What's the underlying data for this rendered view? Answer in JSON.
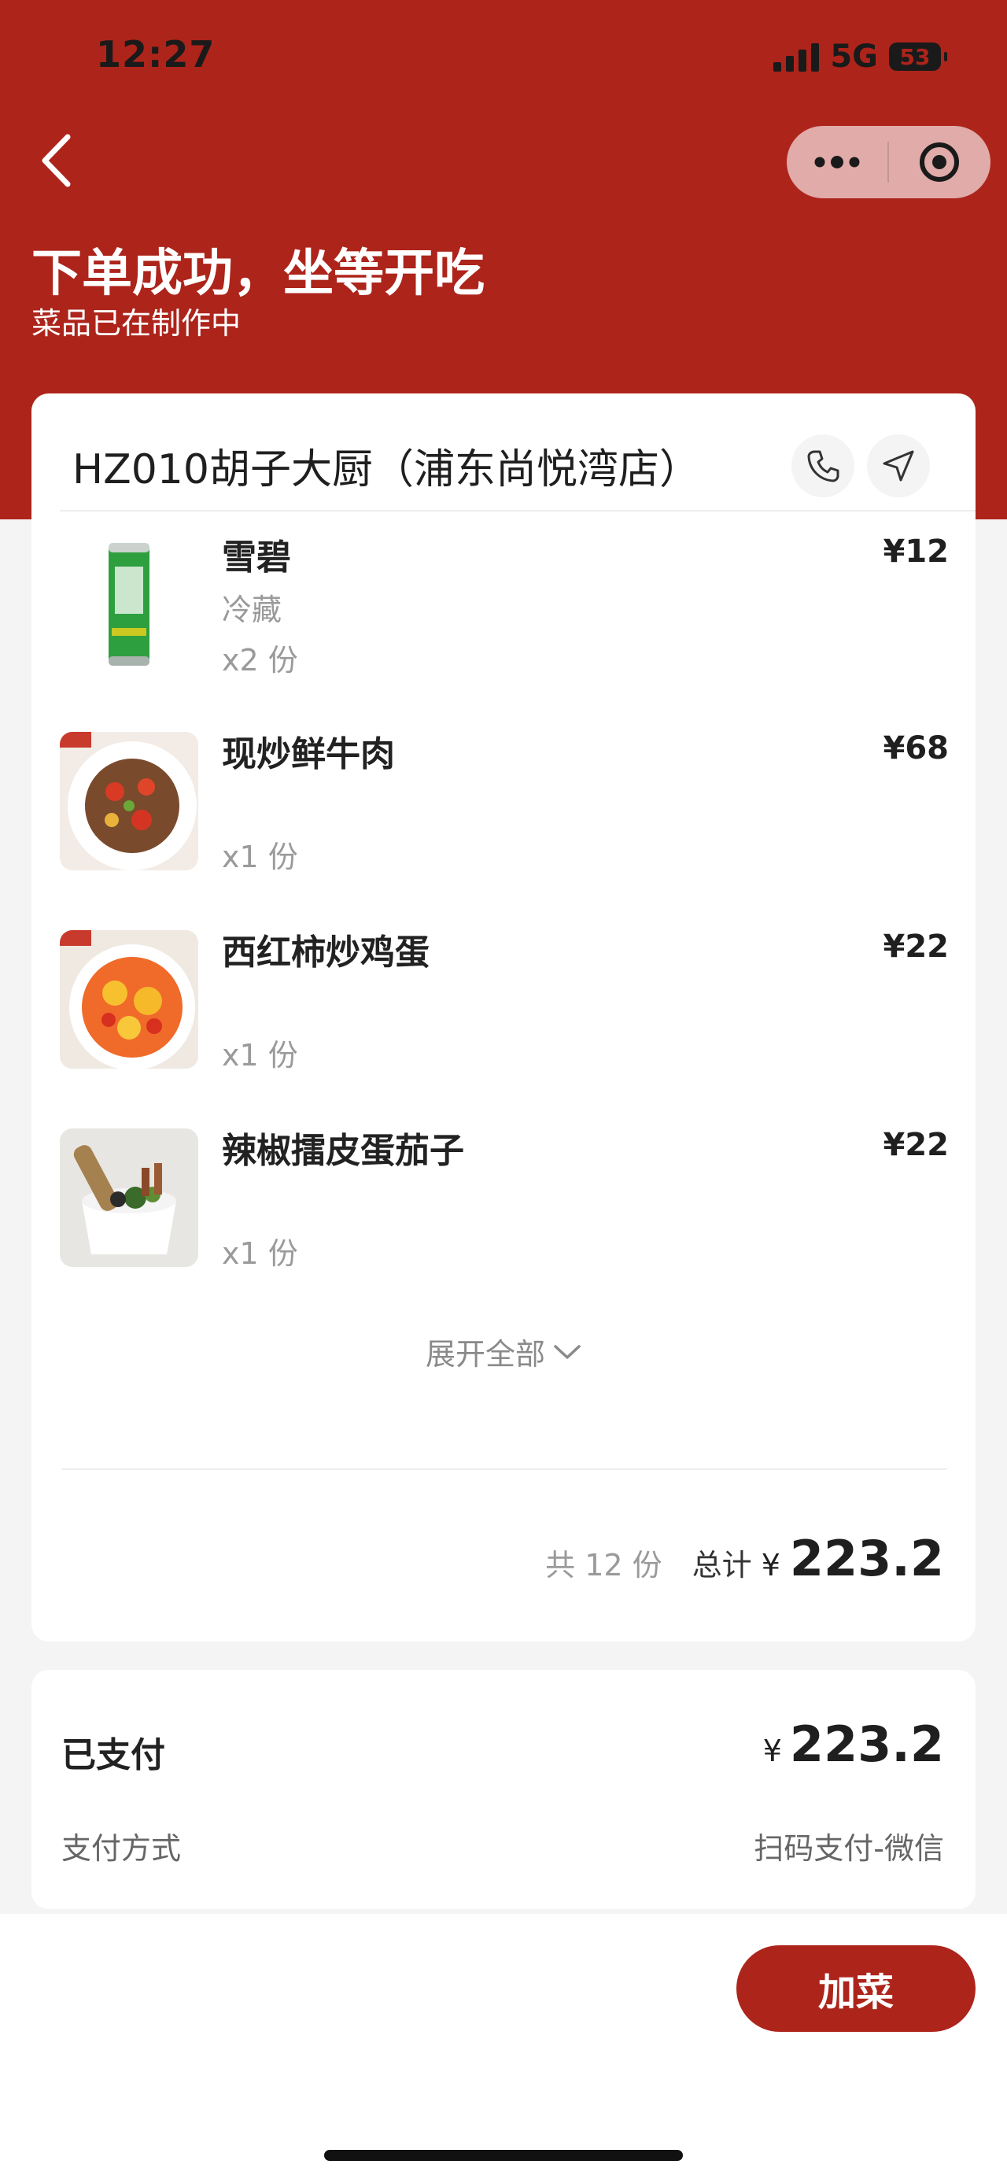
{
  "status_bar": {
    "time": "12:27",
    "network": "5G",
    "battery": "53"
  },
  "nav": {
    "back_icon": "chevron-left-icon",
    "more_icon": "more-dots-icon",
    "close_icon": "target-icon"
  },
  "header": {
    "title": "下单成功，坐等开吃",
    "subtitle": "菜品已在制作中"
  },
  "store": {
    "name": "HZ010胡子大厨（浦东尚悦湾店）",
    "phone_icon": "phone-icon",
    "navigate_icon": "navigation-arrow-icon"
  },
  "dishes": [
    {
      "name": "雪碧",
      "spec": "冷藏",
      "quantity": "x2 份",
      "price": "¥12",
      "image": "sprite-can-image"
    },
    {
      "name": "现炒鲜牛肉",
      "spec": "",
      "quantity": "x1 份",
      "price": "¥68",
      "image": "stir-fried-beef-image"
    },
    {
      "name": "西红柿炒鸡蛋",
      "spec": "",
      "quantity": "x1 份",
      "price": "¥22",
      "image": "tomato-egg-image"
    },
    {
      "name": "辣椒擂皮蛋茄子",
      "spec": "",
      "quantity": "x1 份",
      "price": "¥22",
      "image": "pepper-eggplant-image"
    }
  ],
  "expand_label": "展开全部",
  "summary": {
    "count": "共 12 份",
    "total_label": "总计",
    "currency": "¥",
    "total": "223.2"
  },
  "payment": {
    "paid_label": "已支付",
    "currency": "¥",
    "paid_amount": "223.2",
    "method_label": "支付方式",
    "method_value": "扫码支付-微信"
  },
  "actions": {
    "add_dish": "加菜"
  },
  "colors": {
    "brand_red": "#ad241b",
    "background": "#f4f4f4",
    "card": "#ffffff",
    "muted_text": "#9a9a9a"
  }
}
